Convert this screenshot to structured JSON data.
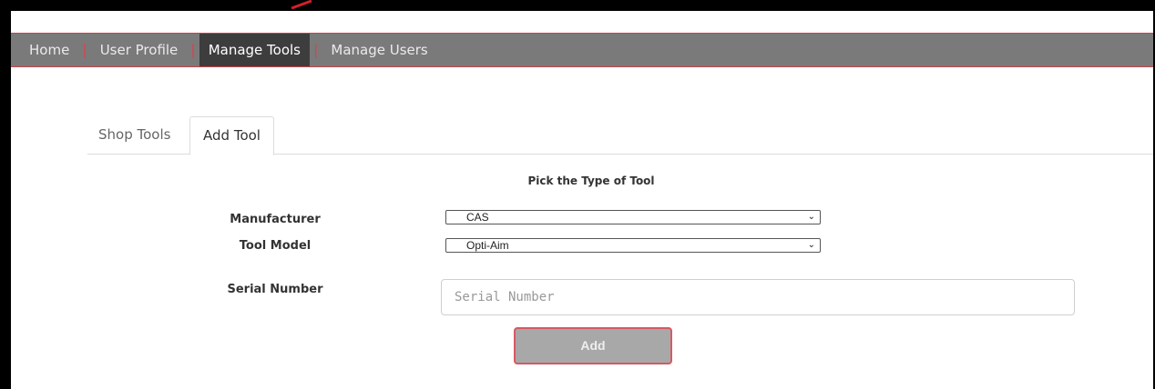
{
  "nav": {
    "items": [
      {
        "label": "Home",
        "active": false
      },
      {
        "label": "User Profile",
        "active": false
      },
      {
        "label": "Manage Tools",
        "active": true
      },
      {
        "label": "Manage Users",
        "active": false
      }
    ],
    "separator": "|"
  },
  "tabs": [
    {
      "label": "Shop Tools",
      "active": false
    },
    {
      "label": "Add Tool",
      "active": true
    }
  ],
  "form": {
    "title": "Pick the Type of Tool",
    "manufacturer_label": "Manufacturer",
    "manufacturer_value": "CAS",
    "model_label": "Tool Model",
    "model_value": "Opti-Aim",
    "serial_label": "Serial Number",
    "serial_placeholder": "Serial Number",
    "add_label": "Add"
  },
  "colors": {
    "navbar": "#7a7a7a",
    "nav_active": "#3d3d3d",
    "accent": "#d8434d",
    "button": "#a8a8a8"
  }
}
